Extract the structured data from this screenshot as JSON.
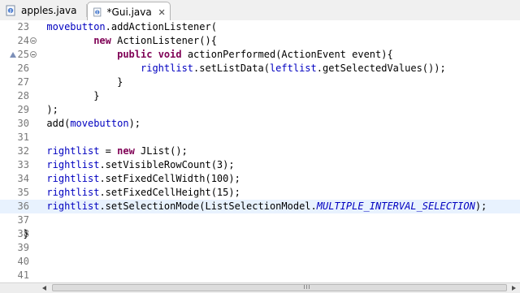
{
  "tabs": [
    {
      "label": "apples.java",
      "active": false,
      "icon": "java-file-icon"
    },
    {
      "label": "*Gui.java",
      "active": true,
      "icon": "java-file-icon",
      "close": "close-icon"
    }
  ],
  "colors": {
    "keyword": "#7f0055",
    "field": "#0000c0",
    "line_number": "#787878",
    "current_line": "#e8f2fe"
  },
  "editor": {
    "current_line": "36",
    "lines": [
      {
        "num": "23",
        "code": "        movebutton.addActionListener("
      },
      {
        "num": "24",
        "code": "                new ActionListener(){"
      },
      {
        "num": "25",
        "code": "                    public void actionPerformed(ActionEvent event){"
      },
      {
        "num": "26",
        "code": "                        rightlist.setListData(leftlist.getSelectedValues());"
      },
      {
        "num": "27",
        "code": "                    }"
      },
      {
        "num": "28",
        "code": "                }"
      },
      {
        "num": "29",
        "code": "        );"
      },
      {
        "num": "30",
        "code": "        add(movebutton);"
      },
      {
        "num": "31",
        "code": ""
      },
      {
        "num": "32",
        "code": "        rightlist = new JList();"
      },
      {
        "num": "33",
        "code": "        rightlist.setVisibleRowCount(3);"
      },
      {
        "num": "34",
        "code": "        rightlist.setFixedCellWidth(100);"
      },
      {
        "num": "35",
        "code": "        rightlist.setFixedCellHeight(15);"
      },
      {
        "num": "36",
        "code": "        rightlist.setSelectionMode(ListSelectionModel.MULTIPLE_INTERVAL_SELECTION);"
      },
      {
        "num": "37",
        "code": ""
      },
      {
        "num": "38",
        "code": "    }"
      },
      {
        "num": "39",
        "code": ""
      },
      {
        "num": "40",
        "code": ""
      },
      {
        "num": "41",
        "code": ""
      }
    ]
  }
}
